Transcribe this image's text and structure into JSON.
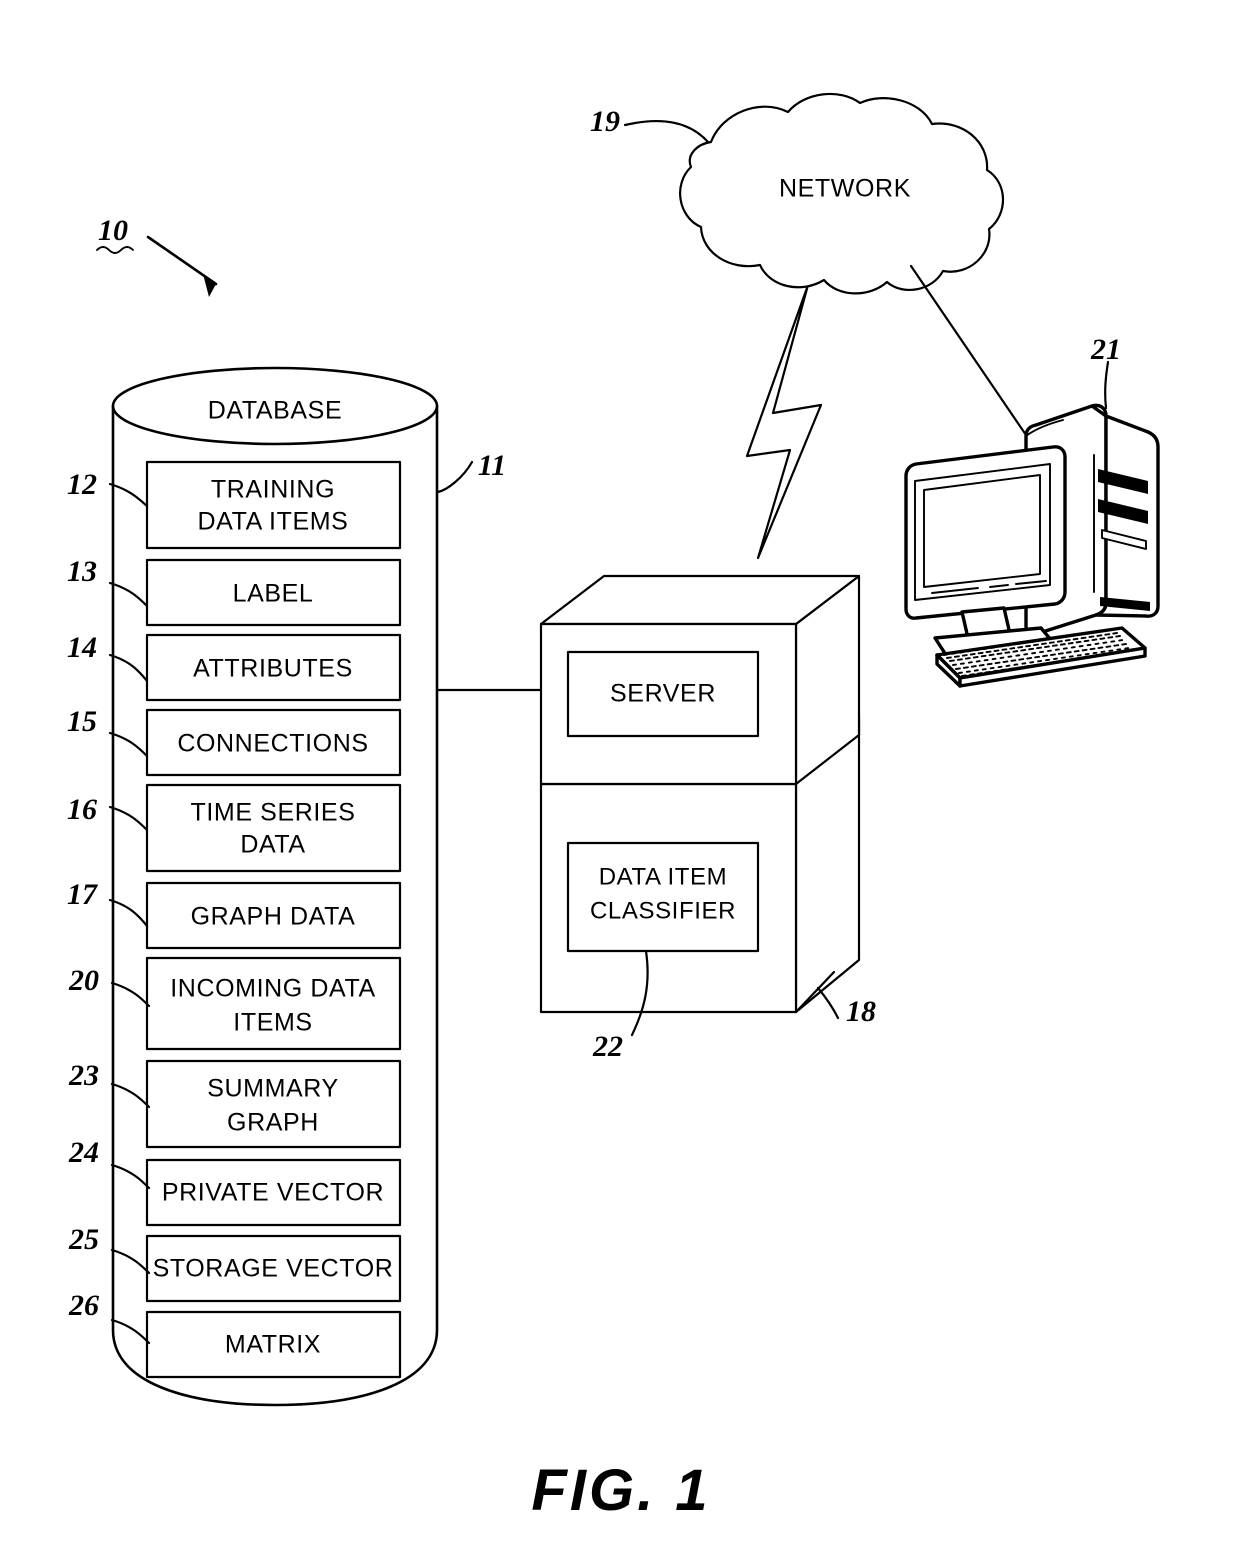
{
  "figure": {
    "caption": "FIG. 1",
    "system_numeral": "10"
  },
  "database": {
    "title": "DATABASE",
    "numeral": "11",
    "items": [
      {
        "numeral": "12",
        "label": "TRAINING DATA ITEMS",
        "lines": [
          "TRAINING",
          "DATA ITEMS"
        ]
      },
      {
        "numeral": "13",
        "label": "LABEL",
        "lines": [
          "LABEL"
        ]
      },
      {
        "numeral": "14",
        "label": "ATTRIBUTES",
        "lines": [
          "ATTRIBUTES"
        ]
      },
      {
        "numeral": "15",
        "label": "CONNECTIONS",
        "lines": [
          "CONNECTIONS"
        ]
      },
      {
        "numeral": "16",
        "label": "TIME SERIES DATA",
        "lines": [
          "TIME SERIES",
          "DATA"
        ]
      },
      {
        "numeral": "17",
        "label": "GRAPH DATA",
        "lines": [
          "GRAPH DATA"
        ]
      },
      {
        "numeral": "20",
        "label": "INCOMING DATA ITEMS",
        "lines": [
          "INCOMING DATA",
          "ITEMS"
        ]
      },
      {
        "numeral": "23",
        "label": "SUMMARY GRAPH",
        "lines": [
          "SUMMARY",
          "GRAPH"
        ]
      },
      {
        "numeral": "24",
        "label": "PRIVATE VECTOR",
        "lines": [
          "PRIVATE VECTOR"
        ]
      },
      {
        "numeral": "25",
        "label": "STORAGE VECTOR",
        "lines": [
          "STORAGE VECTOR"
        ]
      },
      {
        "numeral": "26",
        "label": "MATRIX",
        "lines": [
          "MATRIX"
        ]
      }
    ]
  },
  "server": {
    "numeral": "18",
    "top_label": "SERVER",
    "classifier_numeral": "22",
    "classifier_lines": [
      "DATA ITEM",
      "CLASSIFIER"
    ]
  },
  "network": {
    "label": "NETWORK",
    "numeral": "19"
  },
  "workstation": {
    "numeral": "21"
  }
}
